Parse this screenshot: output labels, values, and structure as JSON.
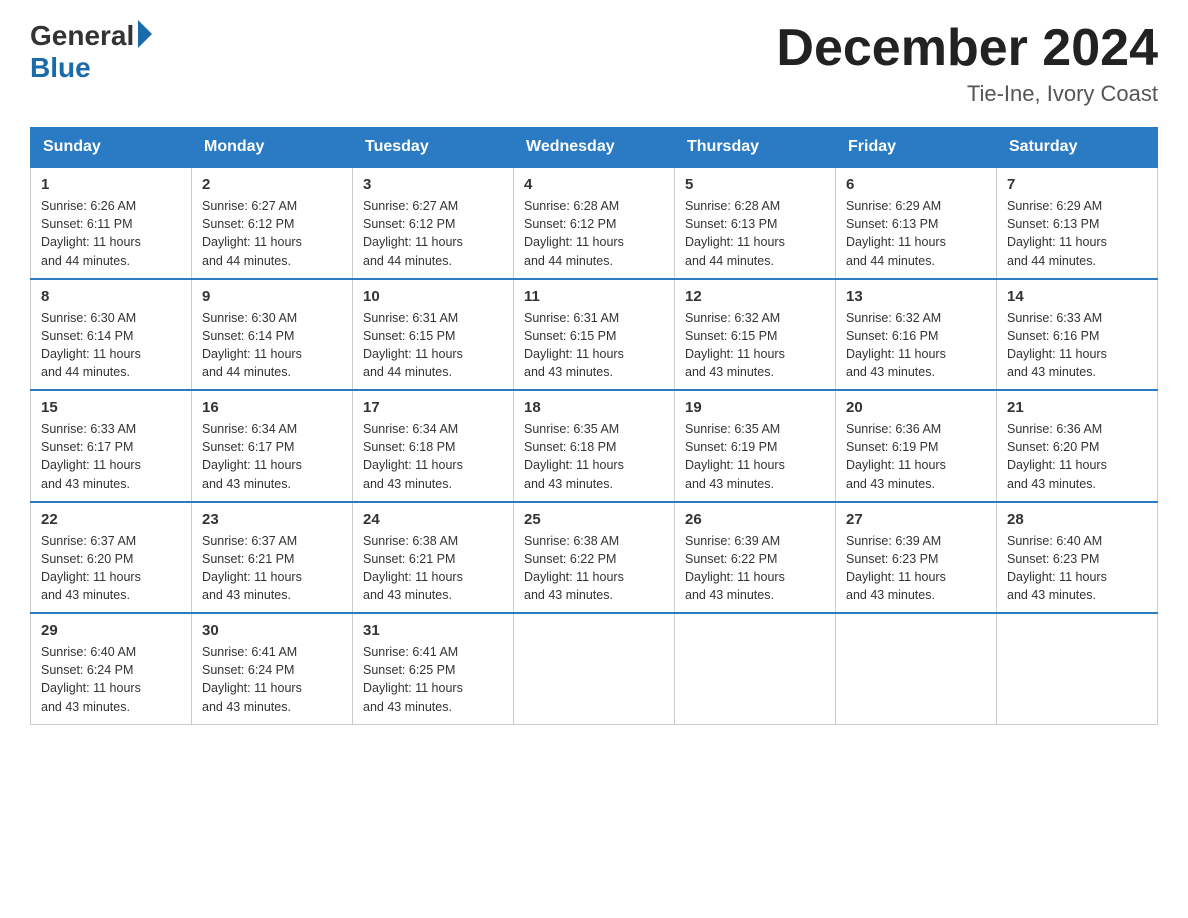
{
  "header": {
    "logo_general": "General",
    "logo_blue": "Blue",
    "month_title": "December 2024",
    "location": "Tie-Ine, Ivory Coast"
  },
  "days_of_week": [
    "Sunday",
    "Monday",
    "Tuesday",
    "Wednesday",
    "Thursday",
    "Friday",
    "Saturday"
  ],
  "weeks": [
    [
      {
        "day": "1",
        "sunrise": "6:26 AM",
        "sunset": "6:11 PM",
        "daylight": "11 hours and 44 minutes."
      },
      {
        "day": "2",
        "sunrise": "6:27 AM",
        "sunset": "6:12 PM",
        "daylight": "11 hours and 44 minutes."
      },
      {
        "day": "3",
        "sunrise": "6:27 AM",
        "sunset": "6:12 PM",
        "daylight": "11 hours and 44 minutes."
      },
      {
        "day": "4",
        "sunrise": "6:28 AM",
        "sunset": "6:12 PM",
        "daylight": "11 hours and 44 minutes."
      },
      {
        "day": "5",
        "sunrise": "6:28 AM",
        "sunset": "6:13 PM",
        "daylight": "11 hours and 44 minutes."
      },
      {
        "day": "6",
        "sunrise": "6:29 AM",
        "sunset": "6:13 PM",
        "daylight": "11 hours and 44 minutes."
      },
      {
        "day": "7",
        "sunrise": "6:29 AM",
        "sunset": "6:13 PM",
        "daylight": "11 hours and 44 minutes."
      }
    ],
    [
      {
        "day": "8",
        "sunrise": "6:30 AM",
        "sunset": "6:14 PM",
        "daylight": "11 hours and 44 minutes."
      },
      {
        "day": "9",
        "sunrise": "6:30 AM",
        "sunset": "6:14 PM",
        "daylight": "11 hours and 44 minutes."
      },
      {
        "day": "10",
        "sunrise": "6:31 AM",
        "sunset": "6:15 PM",
        "daylight": "11 hours and 44 minutes."
      },
      {
        "day": "11",
        "sunrise": "6:31 AM",
        "sunset": "6:15 PM",
        "daylight": "11 hours and 43 minutes."
      },
      {
        "day": "12",
        "sunrise": "6:32 AM",
        "sunset": "6:15 PM",
        "daylight": "11 hours and 43 minutes."
      },
      {
        "day": "13",
        "sunrise": "6:32 AM",
        "sunset": "6:16 PM",
        "daylight": "11 hours and 43 minutes."
      },
      {
        "day": "14",
        "sunrise": "6:33 AM",
        "sunset": "6:16 PM",
        "daylight": "11 hours and 43 minutes."
      }
    ],
    [
      {
        "day": "15",
        "sunrise": "6:33 AM",
        "sunset": "6:17 PM",
        "daylight": "11 hours and 43 minutes."
      },
      {
        "day": "16",
        "sunrise": "6:34 AM",
        "sunset": "6:17 PM",
        "daylight": "11 hours and 43 minutes."
      },
      {
        "day": "17",
        "sunrise": "6:34 AM",
        "sunset": "6:18 PM",
        "daylight": "11 hours and 43 minutes."
      },
      {
        "day": "18",
        "sunrise": "6:35 AM",
        "sunset": "6:18 PM",
        "daylight": "11 hours and 43 minutes."
      },
      {
        "day": "19",
        "sunrise": "6:35 AM",
        "sunset": "6:19 PM",
        "daylight": "11 hours and 43 minutes."
      },
      {
        "day": "20",
        "sunrise": "6:36 AM",
        "sunset": "6:19 PM",
        "daylight": "11 hours and 43 minutes."
      },
      {
        "day": "21",
        "sunrise": "6:36 AM",
        "sunset": "6:20 PM",
        "daylight": "11 hours and 43 minutes."
      }
    ],
    [
      {
        "day": "22",
        "sunrise": "6:37 AM",
        "sunset": "6:20 PM",
        "daylight": "11 hours and 43 minutes."
      },
      {
        "day": "23",
        "sunrise": "6:37 AM",
        "sunset": "6:21 PM",
        "daylight": "11 hours and 43 minutes."
      },
      {
        "day": "24",
        "sunrise": "6:38 AM",
        "sunset": "6:21 PM",
        "daylight": "11 hours and 43 minutes."
      },
      {
        "day": "25",
        "sunrise": "6:38 AM",
        "sunset": "6:22 PM",
        "daylight": "11 hours and 43 minutes."
      },
      {
        "day": "26",
        "sunrise": "6:39 AM",
        "sunset": "6:22 PM",
        "daylight": "11 hours and 43 minutes."
      },
      {
        "day": "27",
        "sunrise": "6:39 AM",
        "sunset": "6:23 PM",
        "daylight": "11 hours and 43 minutes."
      },
      {
        "day": "28",
        "sunrise": "6:40 AM",
        "sunset": "6:23 PM",
        "daylight": "11 hours and 43 minutes."
      }
    ],
    [
      {
        "day": "29",
        "sunrise": "6:40 AM",
        "sunset": "6:24 PM",
        "daylight": "11 hours and 43 minutes."
      },
      {
        "day": "30",
        "sunrise": "6:41 AM",
        "sunset": "6:24 PM",
        "daylight": "11 hours and 43 minutes."
      },
      {
        "day": "31",
        "sunrise": "6:41 AM",
        "sunset": "6:25 PM",
        "daylight": "11 hours and 43 minutes."
      },
      null,
      null,
      null,
      null
    ]
  ],
  "labels": {
    "sunrise": "Sunrise:",
    "sunset": "Sunset:",
    "daylight": "Daylight:"
  }
}
